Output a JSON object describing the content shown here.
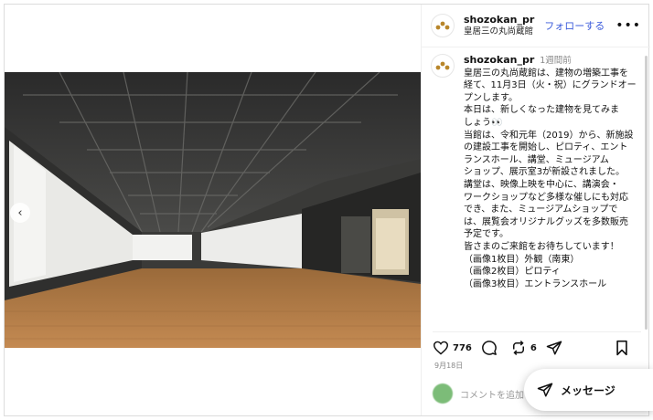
{
  "account": {
    "username": "shozokan_pr",
    "subtitle": "皇居三の丸尚蔵館",
    "follow_label": "フォローする"
  },
  "caption": {
    "username": "shozokan_pr",
    "time_ago": "1週間前",
    "lines": [
      "皇居三の丸尚蔵館は、建物の増築工事を",
      "経て、11月3日（火・祝）にグランドオー",
      "プンします。",
      "本日は、新しくなった建物を見てみま",
      "しょう👀",
      "",
      "当館は、令和元年（2019）から、新施設",
      "の建設工事を開始し、ピロティ、エント",
      "ランスホール、講堂、ミュージアム",
      "ショップ、展示室3が新設されました。",
      "講堂は、映像上映を中心に、講演会・",
      "ワークショップなど多様な催しにも対応",
      "でき、また、ミュージアムショップで",
      "は、展覧会オリジナルグッズを多数販売",
      "予定です。",
      "",
      "皆さまのご来館をお待ちしています！",
      "",
      "（画像1枚目）外観（南東）",
      "（画像2枚目）ピロティ",
      "（画像3枚目）エントランスホール"
    ]
  },
  "actions": {
    "likes": "776",
    "reposts": "6"
  },
  "post_date": "9月18日",
  "comment_placeholder": "コメントを追加",
  "message_button": "メッセージ"
}
